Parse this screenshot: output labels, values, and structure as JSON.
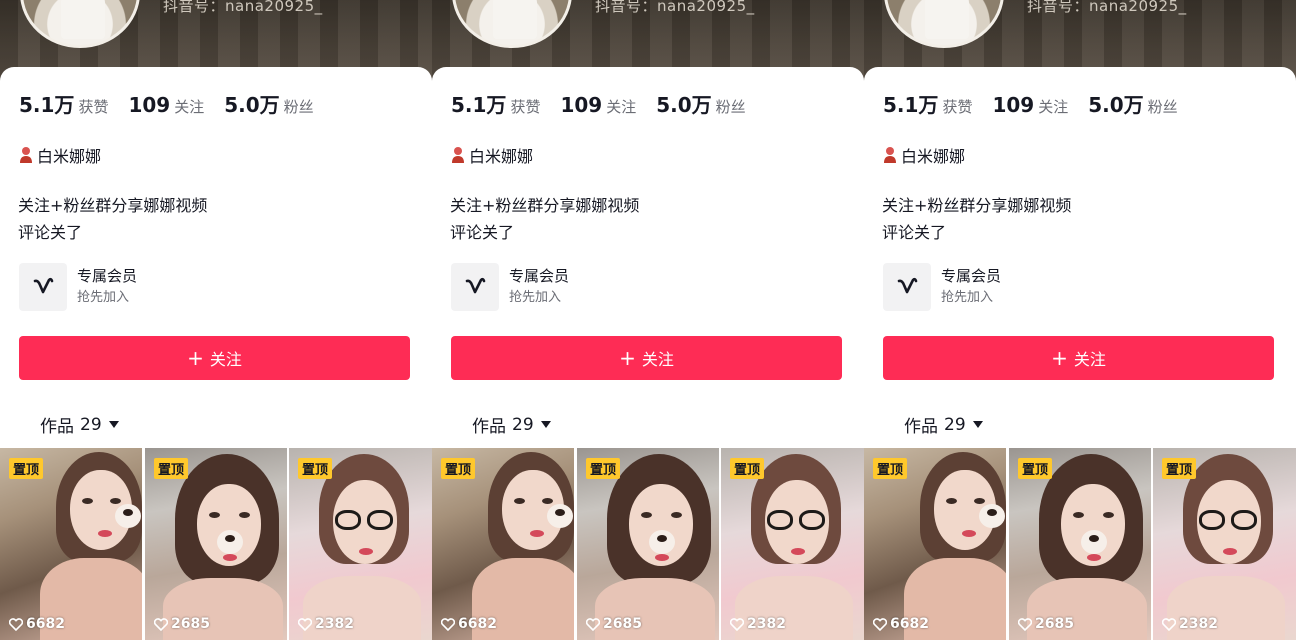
{
  "profile": {
    "douyin_id": "抖音号：nana20925_",
    "stats": [
      {
        "value": "5.1万",
        "label": "获赞"
      },
      {
        "value": "109",
        "label": "关注"
      },
      {
        "value": "5.0万",
        "label": "粉丝"
      }
    ],
    "name": "白米娜娜",
    "bio_line1": "关注+粉丝群分享娜娜视频",
    "bio_line2": "评论关了",
    "member_title": "专属会员",
    "member_sub": "抢先加入",
    "follow_label": "关注",
    "follow_plus": "+",
    "works_label": "作品",
    "works_count": "29"
  },
  "videos": [
    {
      "pin": "置顶",
      "likes": "6682"
    },
    {
      "pin": "置顶",
      "likes": "2685"
    },
    {
      "pin": "置顶",
      "likes": "2382"
    }
  ],
  "colors": {
    "follow_button": "#fe2c55",
    "pin_badge": "#ffc82c",
    "text_primary": "#161823",
    "text_secondary": "#6b6d75"
  },
  "icons": [
    "person-icon",
    "member-v-icon",
    "caret-down-icon",
    "heart-icon"
  ]
}
